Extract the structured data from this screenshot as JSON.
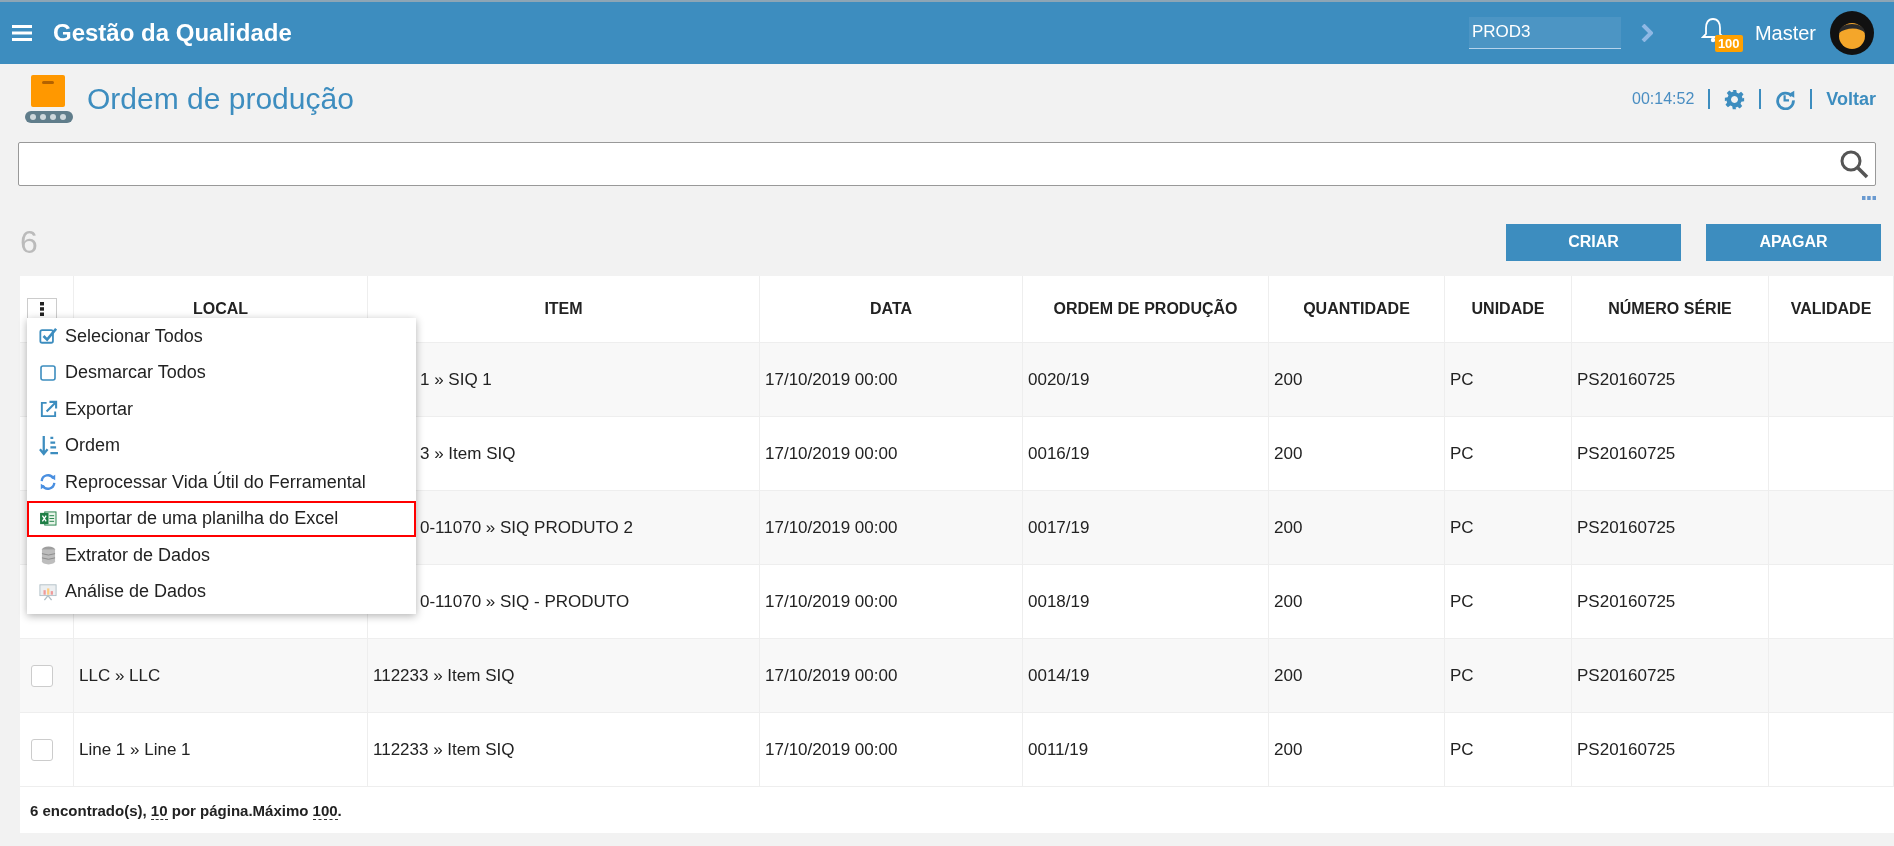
{
  "app_bar": {
    "title": "Gestão da Qualidade",
    "environment": "PROD3",
    "notifications": "100",
    "user": "Master"
  },
  "page": {
    "title": "Ordem de produção",
    "timer": "00:14:52",
    "back": "Voltar"
  },
  "count": "6",
  "buttons": [
    "CRIAR",
    "APAGAR"
  ],
  "table": {
    "columns": [
      "LOCAL",
      "ITEM",
      "DATA",
      "ORDEM DE PRODUÇÃO",
      "QUANTIDADE",
      "UNIDADE",
      "NÚMERO SÉRIE",
      "VALIDADE"
    ],
    "rows": [
      {
        "item": "1 » SIQ 1",
        "date": "17/10/2019 00:00",
        "order": "0020/19",
        "qty": "200",
        "unit": "PC",
        "serial": "PS20160725"
      },
      {
        "item": "3 » Item SIQ",
        "date": "17/10/2019 00:00",
        "order": "0016/19",
        "qty": "200",
        "unit": "PC",
        "serial": "PS20160725"
      },
      {
        "item": "0-11070 » SIQ PRODUTO 2",
        "date": "17/10/2019 00:00",
        "order": "0017/19",
        "qty": "200",
        "unit": "PC",
        "serial": "PS20160725"
      },
      {
        "item": "0-11070 » SIQ - PRODUTO",
        "date": "17/10/2019 00:00",
        "order": "0018/19",
        "qty": "200",
        "unit": "PC",
        "serial": "PS20160725"
      },
      {
        "checked": false,
        "local": "LLC » LLC",
        "item": "112233 » Item SIQ",
        "date": "17/10/2019 00:00",
        "order": "0014/19",
        "qty": "200",
        "unit": "PC",
        "serial": "PS20160725"
      },
      {
        "checked": false,
        "local": "Line 1 » Line 1",
        "item": "112233 » Item SIQ",
        "date": "17/10/2019 00:00",
        "order": "0011/19",
        "qty": "200",
        "unit": "PC",
        "serial": "PS20160725"
      }
    ]
  },
  "menu": [
    {
      "kind": "check",
      "label": "Selecionar Todos",
      "highlighted": false
    },
    {
      "kind": "uncheck",
      "label": "Desmarcar Todos",
      "highlighted": false
    },
    {
      "kind": "export",
      "label": "Exportar",
      "highlighted": false
    },
    {
      "kind": "sort",
      "label": "Ordem",
      "highlighted": false
    },
    {
      "kind": "refresh",
      "label": "Reprocessar Vida Útil do Ferramental",
      "highlighted": false
    },
    {
      "kind": "excel",
      "label": "Importar de uma planilha do Excel",
      "highlighted": true
    },
    {
      "kind": "database",
      "label": "Extrator de Dados",
      "highlighted": false
    },
    {
      "kind": "chart",
      "label": "Análise de Dados",
      "highlighted": false
    }
  ],
  "footer": {
    "found": "6 encontrado(s),",
    "per_page": "10",
    "per_page_text": "por página.Máximo",
    "max": "100",
    "end": "."
  }
}
